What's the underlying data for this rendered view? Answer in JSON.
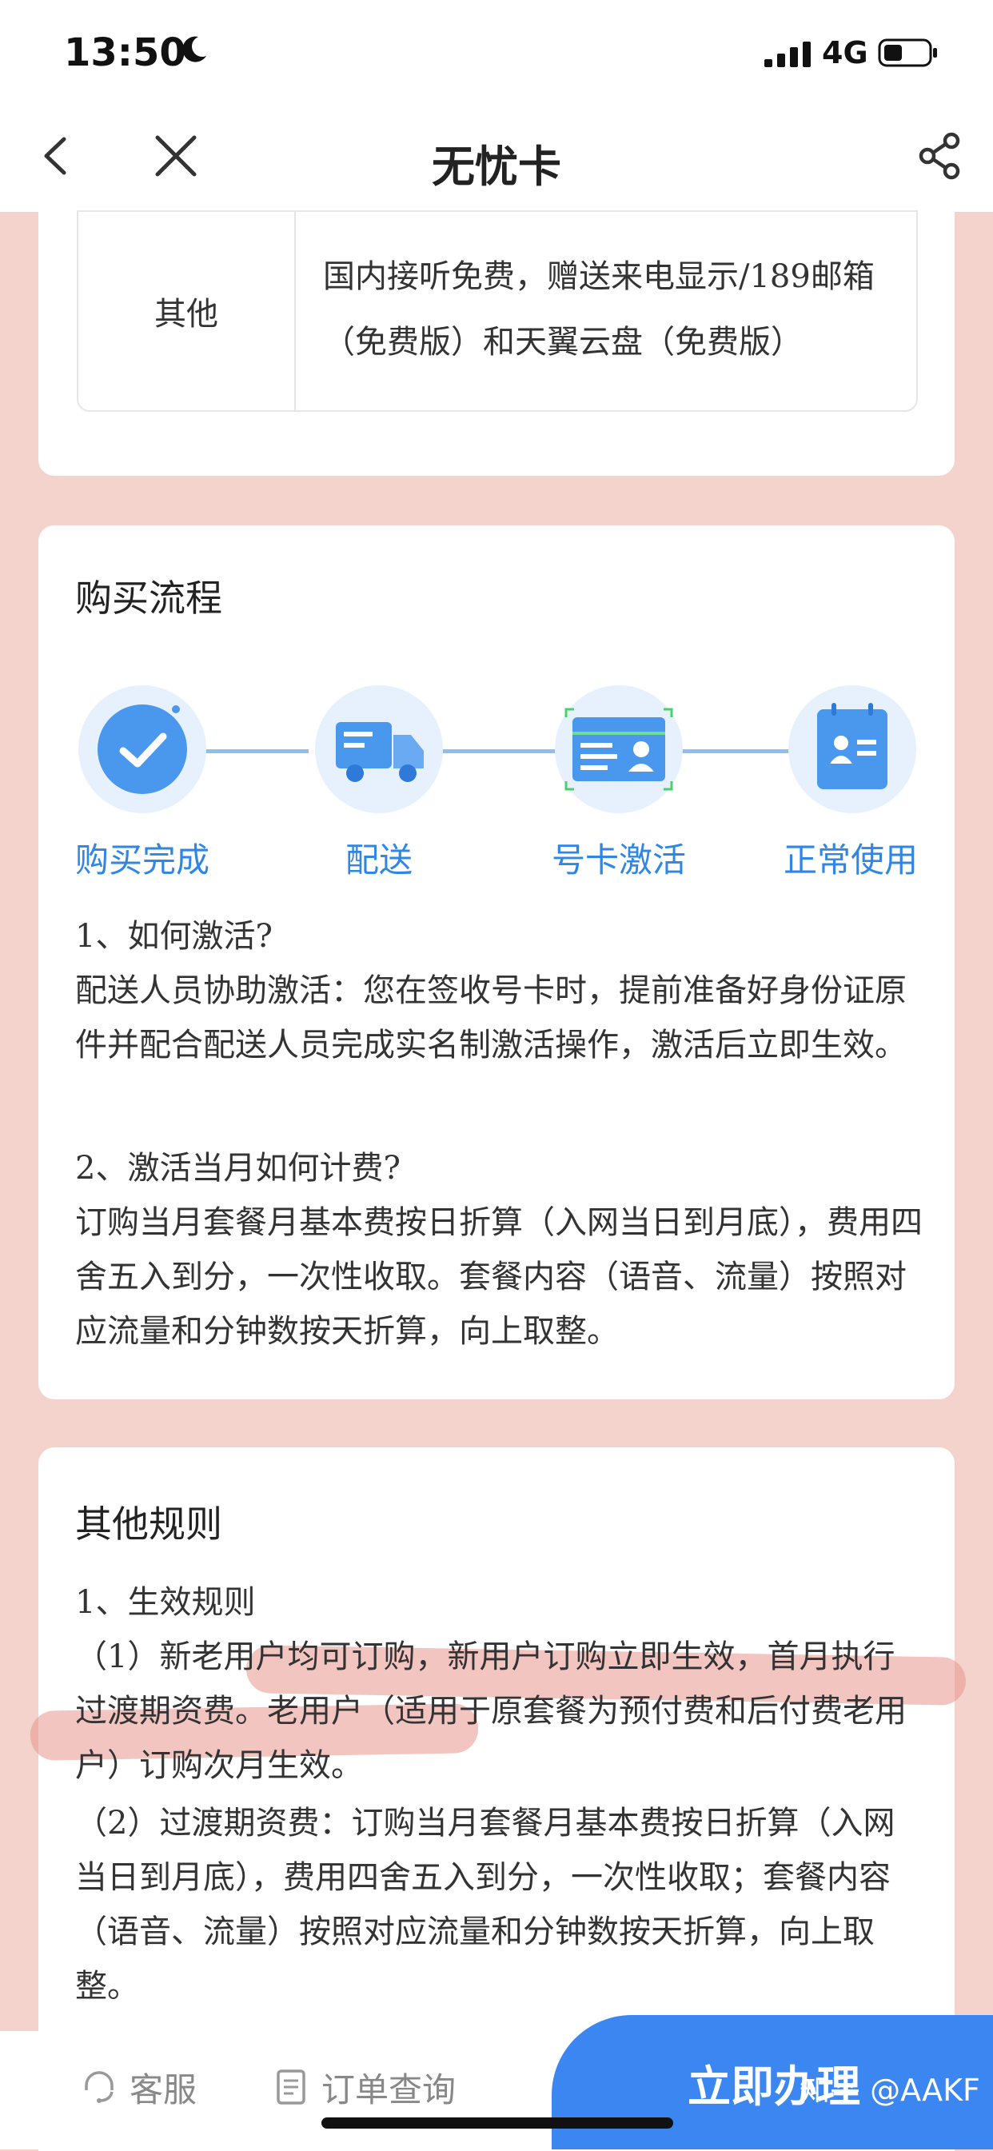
{
  "status": {
    "time": "13:50",
    "network": "4G"
  },
  "nav": {
    "title": "无忧卡"
  },
  "info": {
    "label": "其他",
    "value": "国内接听免费，赠送来电显示/189邮箱（免费版）和天翼云盘（免费版）"
  },
  "process": {
    "title": "购买流程",
    "steps": [
      "购买完成",
      "配送",
      "号卡激活",
      "正常使用"
    ],
    "q1": "1、如何激活?",
    "a1": "配送人员协助激活：您在签收号卡时，提前准备好身份证原件并配合配送人员完成实名制激活操作，激活后立即生效。",
    "q2": "2、激活当月如何计费?",
    "a2": "订购当月套餐月基本费按日折算（入网当日到月底），费用四舍五入到分，一次性收取。套餐内容（语音、流量）按照对应流量和分钟数按天折算，向上取整。"
  },
  "rules": {
    "title": "其他规则",
    "h1": "1、生效规则",
    "p1": "（1）新老用户均可订购，新用户订购立即生效，首月执行过渡期资费。老用户（适用于原套餐为预付费和后付费老用户）订购次月生效。",
    "p2": "（2）过渡期资费：订购当月套餐月基本费按日折算（入网当日到月底），费用四舍五入到分，一次性收取；套餐内容（语音、流量）按照对应流量和分钟数按天折算，向上取整。"
  },
  "bottom": {
    "service": "客服",
    "orders": "订单查询",
    "cta": "立即办理"
  },
  "watermark": "知乎 @AAKF",
  "colors": {
    "accent": "#3b86f0",
    "background": "#f3d3cc",
    "highlight": "#e8968c"
  }
}
